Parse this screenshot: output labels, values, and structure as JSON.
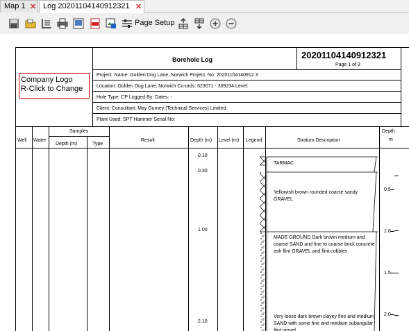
{
  "tabs": [
    {
      "label": "Map 1",
      "active": false
    },
    {
      "label": "Log 20201104140912321",
      "active": true
    }
  ],
  "toolbar": {
    "page_setup_label": "Page Setup",
    "icons": [
      "save-icon",
      "open-folder-icon",
      "chart-axes-icon",
      "print-icon",
      "print-preview-icon",
      "export-pdf-icon",
      "export-image-icon",
      "page-setup-icon",
      "insert-row-above-icon",
      "insert-row-below-icon",
      "zoom-in-icon",
      "zoom-out-icon"
    ]
  },
  "log": {
    "logo_line1": "Company Logo",
    "logo_line2": "R-Click to Change",
    "title": "Borehole Log",
    "log_id": "20201104140912321",
    "page": "Page 1 of 3",
    "project_line": "Project. Name: Golden Dog Lane, Norwich    Project. No: 20201104140912 3",
    "location_line": "Location: Golden Dog Lane, Norwich    Co-ords: 623071 - 309234    Level:",
    "hole_line": "Hole Type: CP    Logged By:        Dates:  -",
    "client_line": "Client:     Consultant: May Gurney (Technical Services) Limited",
    "plant_line": "Plant Used:       SPT Hammer Serial No:",
    "headers": {
      "well": "Well",
      "water": "Water",
      "samples": "Samples",
      "sample_depth": "Depth (m)",
      "sample_type": "Type",
      "result": "Result",
      "depth": "Depth (m)",
      "level": "Level (m)",
      "legend": "Legend",
      "stratum": "Stratum Description",
      "depth_scale_line1": "Depth",
      "depth_scale_line2": "m"
    },
    "depths": [
      "0.10",
      "0.30",
      "1.00",
      "2.10"
    ],
    "strata": [
      "TARMAC",
      "Yellowish brown rounded coarse sandy GRAVEL",
      "MADE GROUND Dark brown medium and coarse SAND and fine to coarse brick concrete ash flint GRAVEL and flint cobbles",
      "Very loose dark brown clayey fine and medium SAND with some fine and medium subangular flint gravel"
    ],
    "scale_ticks": [
      "0.5",
      "1.0",
      "1.5",
      "2.0"
    ]
  }
}
